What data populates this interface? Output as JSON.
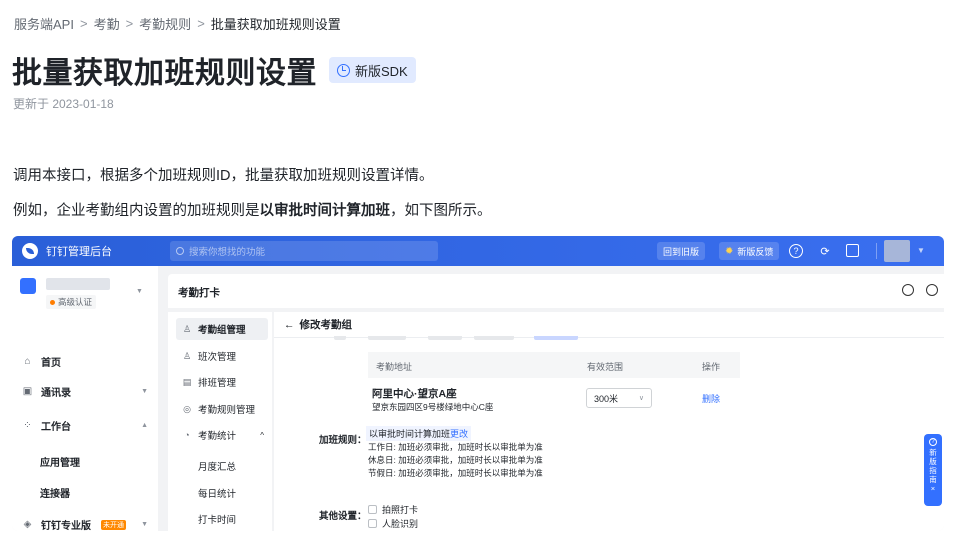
{
  "breadcrumb": {
    "items": [
      "服务端API",
      "考勤",
      "考勤规则"
    ],
    "current": "批量获取加班规则设置",
    "separator": ">"
  },
  "page": {
    "title": "批量获取加班规则设置",
    "sdk_badge": "新版SDK",
    "updated": "更新于 2023-01-18",
    "para1": "调用本接口，根据多个加班规则ID，批量获取加班规则设置详情。",
    "para2_prefix": "例如，企业考勤组内设置的加班规则是",
    "para2_bold": "以审批时间计算加班",
    "para2_suffix": "，如下图所示。"
  },
  "screenshot": {
    "topbar": {
      "app_name": "钉钉管理后台",
      "search_placeholder": "搜索你想找的功能",
      "old_version": "回到旧版",
      "feedback": "新版反馈",
      "help_glyph": "?",
      "refresh_glyph": "⟳"
    },
    "sidebar": {
      "cert": "高级认证",
      "items": [
        {
          "icon": "⌂",
          "label": "首页",
          "caret": ""
        },
        {
          "icon": "▣",
          "label": "通讯录",
          "caret": "▼"
        },
        {
          "icon": "⁘",
          "label": "工作台",
          "caret": "▲"
        }
      ],
      "sub_items": [
        "应用管理",
        "连接器"
      ],
      "pro": {
        "icon": "◈",
        "label": "钉钉专业版",
        "tag": "未开通",
        "caret": "▼"
      }
    },
    "content_title": "考勤打卡",
    "subnav": {
      "items": [
        {
          "icon": "♙",
          "label": "考勤组管理"
        },
        {
          "icon": "♙",
          "label": "班次管理"
        },
        {
          "icon": "▤",
          "label": "排班管理"
        },
        {
          "icon": "◎",
          "label": "考勤规则管理"
        },
        {
          "icon": "◔",
          "label": "考勤统计",
          "caret": "^"
        }
      ],
      "sub_items": [
        "月度汇总",
        "每日统计",
        "打卡时间"
      ]
    },
    "panel": {
      "back_label": "修改考勤组",
      "back_arrow": "←",
      "table_headers": [
        "考勤地址",
        "有效范围",
        "操作"
      ],
      "location_name": "阿里中心·望京A座",
      "location_address": "望京东园四区9号楼绿地中心C座",
      "range_value": "300米",
      "delete_label": "删除",
      "rule_label": "加班规则：",
      "rule_main": "以审批时间计算加班",
      "rule_change": "更改",
      "rule_lines": [
        "工作日: 加班必须审批，加班时长以审批单为准",
        "休息日: 加班必须审批，加班时长以审批单为准",
        "节假日: 加班必须审批，加班时长以审批单为准"
      ],
      "other_label": "其他设置：",
      "other_options": [
        "拍照打卡",
        "人脸识别"
      ]
    },
    "guide": {
      "icon": "?",
      "chars": [
        "新",
        "版",
        "指",
        "南"
      ],
      "close": "×"
    },
    "colors": {
      "topbar": "#2a5fd8",
      "accent": "#3370ff",
      "badge_bg": "#e1eaff"
    }
  }
}
